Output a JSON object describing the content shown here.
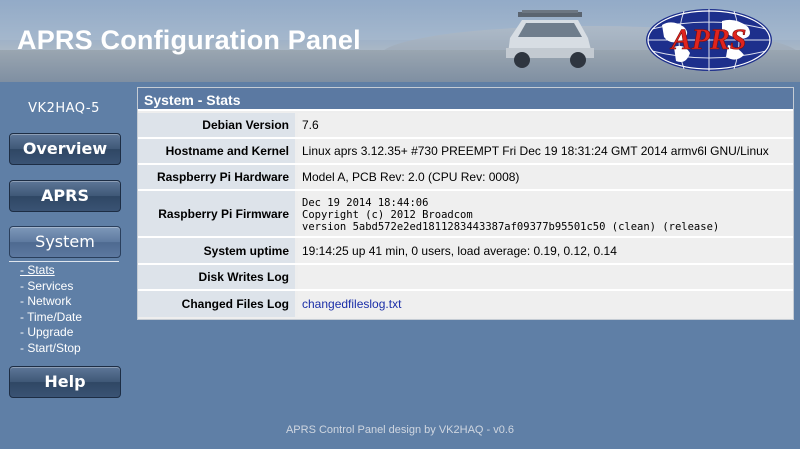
{
  "header": {
    "title": "APRS Configuration Panel",
    "logo_text": "APRS"
  },
  "sidebar": {
    "callsign": "VK2HAQ-5",
    "buttons": [
      {
        "label": "Overview"
      },
      {
        "label": "APRS"
      },
      {
        "label": "System"
      },
      {
        "label": "Help"
      }
    ],
    "submenu": [
      "- Stats",
      "- Services",
      "- Network",
      "- Time/Date",
      "- Upgrade",
      "- Start/Stop"
    ]
  },
  "panel": {
    "title": "System - Stats",
    "rows": [
      {
        "label": "Debian Version",
        "value": "7.6"
      },
      {
        "label": "Hostname and Kernel",
        "value": "Linux aprs 3.12.35+ #730 PREEMPT Fri Dec 19 18:31:24 GMT 2014 armv6l GNU/Linux"
      },
      {
        "label": "Raspberry Pi Hardware",
        "value": "Model A, PCB Rev: 2.0 (CPU Rev: 0008)"
      },
      {
        "label": "Raspberry Pi Firmware",
        "value": "Dec 19 2014 18:44:06\nCopyright (c) 2012 Broadcom\nversion 5abd572e2ed1811283443387af09377b95501c50 (clean) (release)"
      },
      {
        "label": "System uptime",
        "value": "19:14:25 up 41 min, 0 users, load average: 0.19, 0.12, 0.14"
      },
      {
        "label": "Disk Writes Log",
        "value": ""
      },
      {
        "label": "Changed Files Log",
        "value": "changedfileslog.txt"
      }
    ]
  },
  "footer": {
    "text": "APRS Control Panel design by VK2HAQ - v0.6"
  }
}
